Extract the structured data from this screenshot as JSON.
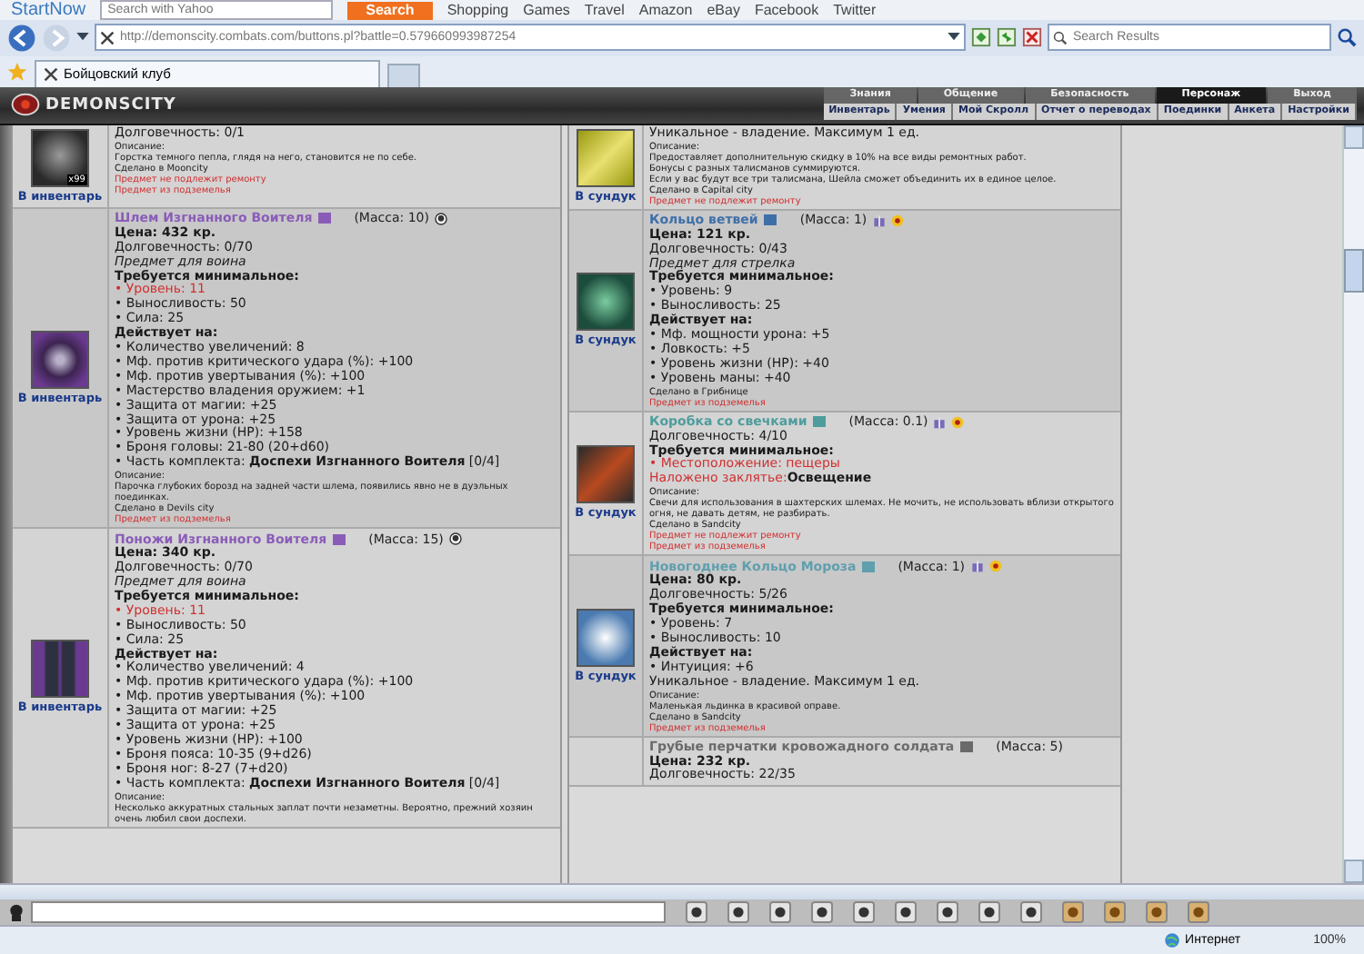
{
  "browser": {
    "toolbar": {
      "logo": "StartNow",
      "search_placeholder": "Search with Yahoo",
      "search_button": "Search",
      "links": [
        "Shopping",
        "Games",
        "Travel",
        "Amazon",
        "eBay",
        "Facebook",
        "Twitter"
      ]
    },
    "address": "http://demonscity.combats.com/buttons.pl?battle=0.579660993987254",
    "search_placeholder": "Search Results",
    "tabs": [
      {
        "label": "Бойцовский клуб",
        "selected": true
      }
    ]
  },
  "game": {
    "logo": "DEMONSCITY",
    "menu": [
      {
        "label": "Знания",
        "selected": false
      },
      {
        "label": "Общение",
        "selected": false
      },
      {
        "label": "Безопасность",
        "selected": false
      },
      {
        "label": "Персонаж",
        "selected": true
      },
      {
        "label": "Выход",
        "selected": false
      }
    ],
    "submenu": [
      "Инвентарь",
      "Умения",
      "Мой Скролл",
      "Отчет о переводах",
      "Поединки",
      "Анкета",
      "Настройки"
    ]
  },
  "columns": [
    [
      {
        "action": "В инвентарь",
        "picture": {
          "kind": "ash"
        },
        "count": "x99",
        "lines": [
          {
            "kind": "plain",
            "text": "Долговечность: 0/1"
          },
          {
            "kind": "small",
            "text": "Описание:"
          },
          {
            "kind": "small",
            "text": "Горстка темного пепла, глядя на него, становится не по себе."
          },
          {
            "kind": "small",
            "text": "Сделано в Mooncity"
          },
          {
            "kind": "warn",
            "text": "Предмет не подлежит ремонту"
          },
          {
            "kind": "warn",
            "text": "Предмет из подземелья"
          }
        ]
      },
      {
        "action": "В инвентарь",
        "picture": {
          "kind": "helmet"
        },
        "name": "Шлем Изгнанного Воителя",
        "color": "#8a5cb8",
        "mass": "(Масса: 10)",
        "icons": [
          {
            "kind": "coin"
          }
        ],
        "lines": [
          {
            "kind": "price",
            "text": "Цена: 432 кр."
          },
          {
            "kind": "plain",
            "text": "Долговечность: 0/70"
          },
          {
            "kind": "italic",
            "text": "Предмет для воина"
          },
          {
            "kind": "heading",
            "text": "Требуется минимальное:"
          },
          {
            "kind": "unmet",
            "text": "• Уровень: 11"
          },
          {
            "kind": "bullet",
            "text": "• Выносливость: 50"
          },
          {
            "kind": "bullet",
            "text": "• Сила: 25"
          },
          {
            "kind": "heading",
            "text": "Действует на:"
          },
          {
            "kind": "bullet",
            "text": "• Количество увеличений: 8"
          },
          {
            "kind": "bullet",
            "text": "• Мф. против критического удара (%): +100"
          },
          {
            "kind": "bullet",
            "text": "• Мф. против увертывания (%): +100"
          },
          {
            "kind": "bullet",
            "text": "• Мастерство владения оружием: +1"
          },
          {
            "kind": "bullet",
            "text": "• Защита от магии: +25"
          },
          {
            "kind": "bullet",
            "text": "• Защита от урона: +25"
          },
          {
            "kind": "bullet",
            "text": "• Уровень жизни (HP): +158"
          },
          {
            "kind": "bullet",
            "text": "• Броня головы: 21-80 (20+d60)"
          },
          {
            "kind": "set",
            "text": "• Часть комплекта: **Доспехи Изгнанного Воителя** [0/4]"
          },
          {
            "kind": "small",
            "text": "Описание:"
          },
          {
            "kind": "small",
            "text": "Парочка глубоких борозд на задней части шлема, появились явно не в дуэльных поединках."
          },
          {
            "kind": "small",
            "text": "Сделано в Devils city"
          },
          {
            "kind": "warn",
            "text": "Предмет из подземелья"
          }
        ]
      },
      {
        "action": "В инвентарь",
        "picture": {
          "kind": "pants"
        },
        "name": "Поножи Изгнанного Воителя",
        "color": "#8a5cb8",
        "mass": "(Масса: 15)",
        "icons": [
          {
            "kind": "coin"
          }
        ],
        "lines": [
          {
            "kind": "price",
            "text": "Цена: 340 кр."
          },
          {
            "kind": "plain",
            "text": "Долговечность: 0/70"
          },
          {
            "kind": "italic",
            "text": "Предмет для воина"
          },
          {
            "kind": "heading",
            "text": "Требуется минимальное:"
          },
          {
            "kind": "unmet",
            "text": "• Уровень: 11"
          },
          {
            "kind": "bullet",
            "text": "• Выносливость: 50"
          },
          {
            "kind": "bullet",
            "text": "• Сила: 25"
          },
          {
            "kind": "heading",
            "text": "Действует на:"
          },
          {
            "kind": "bullet",
            "text": "• Количество увеличений: 4"
          },
          {
            "kind": "bullet",
            "text": "• Мф. против критического удара (%): +100"
          },
          {
            "kind": "bullet",
            "text": "• Мф. против увертывания (%): +100"
          },
          {
            "kind": "bullet",
            "text": "• Защита от магии: +25"
          },
          {
            "kind": "bullet",
            "text": "• Защита от урона: +25"
          },
          {
            "kind": "bullet",
            "text": "• Уровень жизни (HP): +100"
          },
          {
            "kind": "bullet",
            "text": "• Броня пояса: 10-35 (9+d26)"
          },
          {
            "kind": "bullet",
            "text": "• Броня ног: 8-27 (7+d20)"
          },
          {
            "kind": "set",
            "text": "• Часть комплекта: **Доспехи Изгнанного Воителя** [0/4]"
          },
          {
            "kind": "small",
            "text": "Описание:"
          },
          {
            "kind": "small",
            "text": "Несколько аккуратных стальных заплат почти незаметны. Вероятно, прежний хозяин очень любил свои доспехи."
          }
        ]
      }
    ],
    [
      {
        "action": "В сундук",
        "picture": {
          "kind": "card"
        },
        "lines": [
          {
            "kind": "plain",
            "text": "Уникальное - владение. Максимум 1 ед."
          },
          {
            "kind": "small",
            "text": "Описание:"
          },
          {
            "kind": "small",
            "text": "Предоставляет дополнительную скидку в 10% на все виды ремонтных работ."
          },
          {
            "kind": "small",
            "text": "Бонусы с разных талисманов суммируются."
          },
          {
            "kind": "small",
            "text": "Если у вас будут все три талисмана, Шейла сможет объединить их в единое целое."
          },
          {
            "kind": "small",
            "text": "Сделано в Capital city"
          },
          {
            "kind": "warn",
            "text": "Предмет не подлежит ремонту"
          }
        ]
      },
      {
        "action": "В сундук",
        "picture": {
          "kind": "ring"
        },
        "name": "Кольцо ветвей",
        "color": "#3f6fa8",
        "mass": "(Масса: 1)",
        "icons": [
          {
            "kind": "gift"
          },
          {
            "kind": "medal"
          }
        ],
        "lines": [
          {
            "kind": "price",
            "text": "Цена: 121 кр."
          },
          {
            "kind": "plain",
            "text": "Долговечность: 0/43"
          },
          {
            "kind": "italic",
            "text": "Предмет для стрелка"
          },
          {
            "kind": "heading",
            "text": "Требуется минимальное:"
          },
          {
            "kind": "bullet",
            "text": "• Уровень: 9"
          },
          {
            "kind": "bullet",
            "text": "• Выносливость: 25"
          },
          {
            "kind": "heading",
            "text": "Действует на:"
          },
          {
            "kind": "bullet",
            "text": "• Мф. мощности урона: +5"
          },
          {
            "kind": "bullet",
            "text": "• Ловкость: +5"
          },
          {
            "kind": "bullet",
            "text": "• Уровень жизни (HP): +40"
          },
          {
            "kind": "bullet",
            "text": "• Уровень маны: +40"
          },
          {
            "kind": "small",
            "text": "Сделано в Грибнице"
          },
          {
            "kind": "warn",
            "text": "Предмет из подземелья"
          }
        ]
      },
      {
        "action": "В сундук",
        "picture": {
          "kind": "candles"
        },
        "name": "Коробка со свечками",
        "color": "#4f9c9c",
        "mass": "(Масса: 0.1)",
        "icons": [
          {
            "kind": "gift"
          },
          {
            "kind": "medal"
          }
        ],
        "lines": [
          {
            "kind": "plain",
            "text": "Долговечность: 4/10"
          },
          {
            "kind": "heading",
            "text": "Требуется минимальное:"
          },
          {
            "kind": "unmet",
            "text": "• Местоположение: пещеры"
          },
          {
            "kind": "spell",
            "label": "Наложено заклятье:",
            "value": "Освещение"
          },
          {
            "kind": "small",
            "text": "Описание:"
          },
          {
            "kind": "small",
            "text": "Свечи для использования в шахтерских шлемах. Не мочить, не использовать вблизи открытого огня, не давать детям, не разбирать."
          },
          {
            "kind": "small",
            "text": "Сделано в Sandcity"
          },
          {
            "kind": "warn",
            "text": "Предмет не подлежит ремонту"
          },
          {
            "kind": "warn",
            "text": "Предмет из подземелья"
          }
        ]
      },
      {
        "action": "В сундук",
        "picture": {
          "kind": "ice"
        },
        "name": "Новогоднее Кольцо Мороза",
        "color": "#5f9fae",
        "mass": "(Масса: 1)",
        "icons": [
          {
            "kind": "gift"
          },
          {
            "kind": "medal"
          }
        ],
        "lines": [
          {
            "kind": "price",
            "text": "Цена: 80 кр."
          },
          {
            "kind": "plain",
            "text": "Долговечность: 5/26"
          },
          {
            "kind": "heading",
            "text": "Требуется минимальное:"
          },
          {
            "kind": "bullet",
            "text": "• Уровень: 7"
          },
          {
            "kind": "bullet",
            "text": "• Выносливость: 10"
          },
          {
            "kind": "heading",
            "text": "Действует на:"
          },
          {
            "kind": "bullet",
            "text": "• Интуиция: +6"
          },
          {
            "kind": "plain",
            "text": "Уникальное - владение. Максимум 1 ед."
          },
          {
            "kind": "small",
            "text": "Описание:"
          },
          {
            "kind": "small",
            "text": "Маленькая льдинка в красивой оправе."
          },
          {
            "kind": "small",
            "text": "Сделано в Sandcity"
          },
          {
            "kind": "warn",
            "text": "Предмет из подземелья"
          }
        ]
      },
      {
        "name": "Грубые перчатки кровожадного солдата",
        "color": "#6a6a6a",
        "mass": "(Масса: 5)",
        "lines": [
          {
            "kind": "price",
            "text": "Цена: 232 кр."
          },
          {
            "kind": "plain",
            "text": "Долговечность: 22/35"
          }
        ]
      }
    ]
  ],
  "status_bar": {
    "zone": "Интернет",
    "zoom": "100%"
  }
}
